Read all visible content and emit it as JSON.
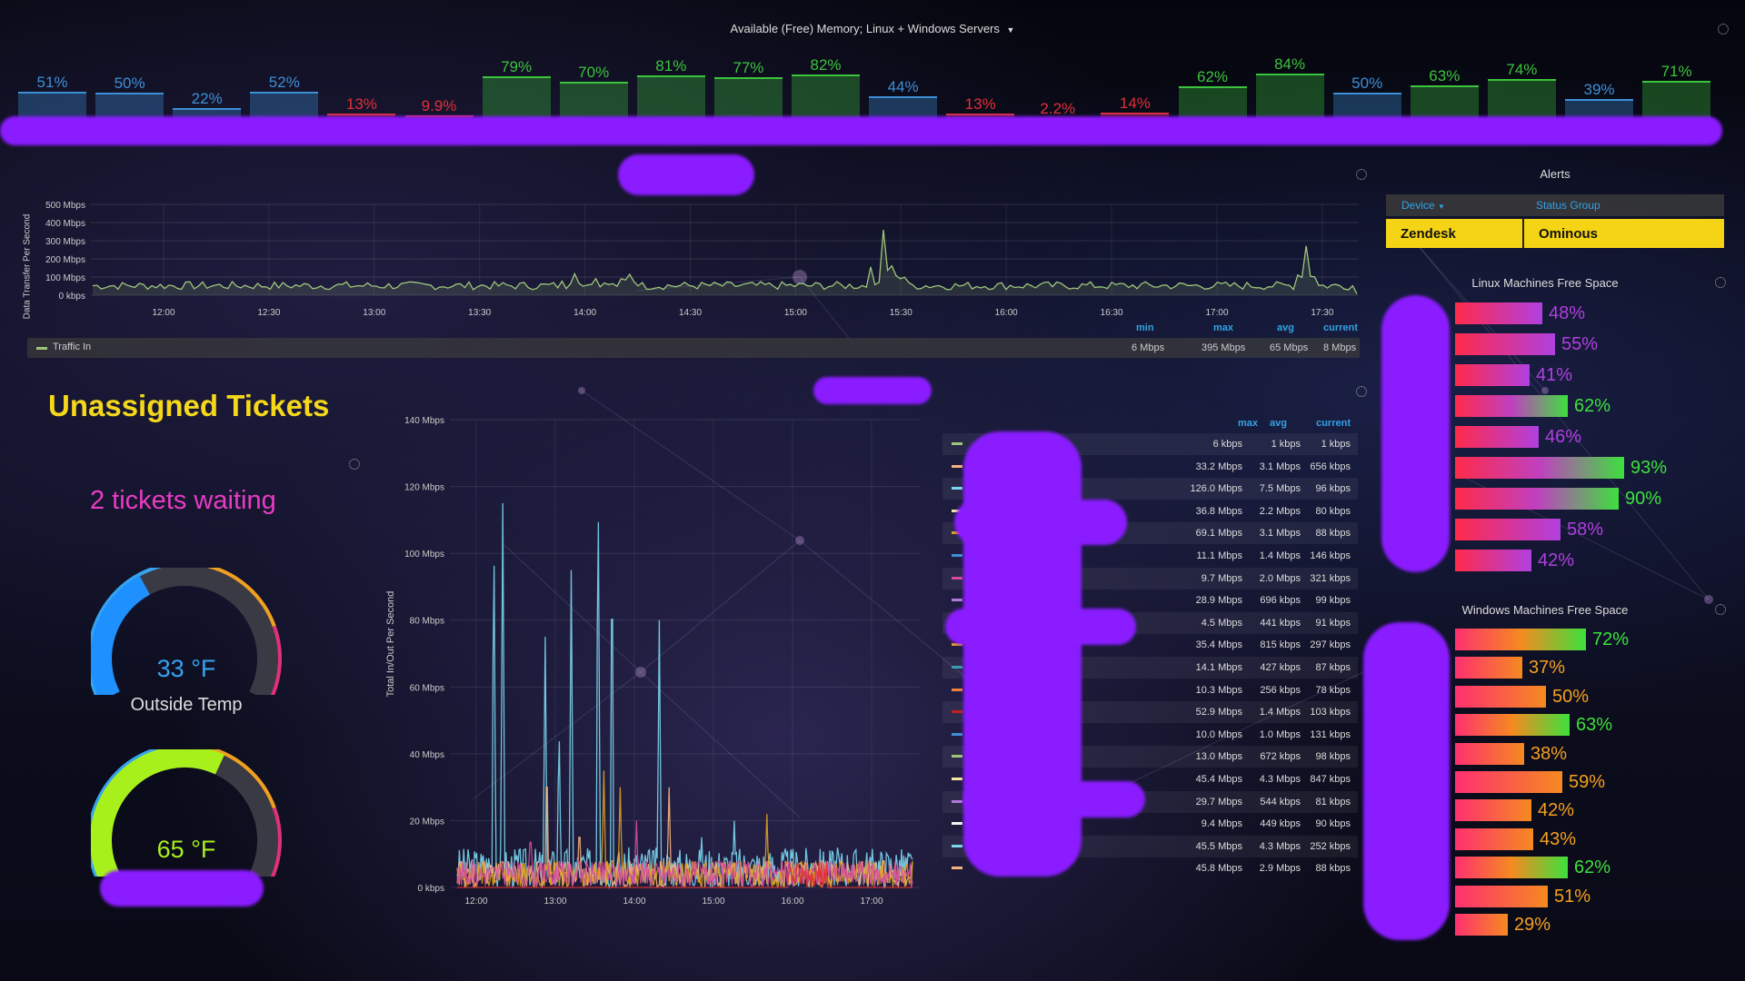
{
  "memory_panel": {
    "title": "Available (Free) Memory; Linux + Windows Servers",
    "bars": [
      {
        "value": 51,
        "label": "51%",
        "color": "#3d8fd8"
      },
      {
        "value": 50,
        "label": "50%",
        "color": "#3d8fd8"
      },
      {
        "value": 22,
        "label": "22%",
        "color": "#3d8fd8"
      },
      {
        "value": 52,
        "label": "52%",
        "color": "#3d8fd8"
      },
      {
        "value": 13,
        "label": "13%",
        "color": "#e0303a"
      },
      {
        "value": 9.9,
        "label": "9.9%",
        "color": "#e0303a"
      },
      {
        "value": 79,
        "label": "79%",
        "color": "#3cc43c"
      },
      {
        "value": 70,
        "label": "70%",
        "color": "#3cc43c"
      },
      {
        "value": 81,
        "label": "81%",
        "color": "#3cc43c"
      },
      {
        "value": 77,
        "label": "77%",
        "color": "#3cc43c"
      },
      {
        "value": 82,
        "label": "82%",
        "color": "#3cc43c"
      },
      {
        "value": 44,
        "label": "44%",
        "color": "#3d8fd8"
      },
      {
        "value": 13,
        "label": "13%",
        "color": "#e0303a"
      },
      {
        "value": 2.2,
        "label": "2.2%",
        "color": "#e0303a"
      },
      {
        "value": 14,
        "label": "14%",
        "color": "#e0303a"
      },
      {
        "value": 62,
        "label": "62%",
        "color": "#3cc43c"
      },
      {
        "value": 84,
        "label": "84%",
        "color": "#3cc43c"
      },
      {
        "value": 50,
        "label": "50%",
        "color": "#3d8fd8"
      },
      {
        "value": 63,
        "label": "63%",
        "color": "#3cc43c"
      },
      {
        "value": 74,
        "label": "74%",
        "color": "#3cc43c"
      },
      {
        "value": 39,
        "label": "39%",
        "color": "#3d8fd8"
      },
      {
        "value": 71,
        "label": "71%",
        "color": "#3cc43c"
      }
    ]
  },
  "traffic_chart": {
    "ylabel": "Data Transfer Per Second",
    "yticks": [
      "500 Mbps",
      "400 Mbps",
      "300 Mbps",
      "200 Mbps",
      "100 Mbps",
      "0 kbps"
    ],
    "xticks": [
      "12:00",
      "12:30",
      "13:00",
      "13:30",
      "14:00",
      "14:30",
      "15:00",
      "15:30",
      "16:00",
      "16:30",
      "17:00",
      "17:30"
    ],
    "legend": {
      "series": "Traffic In",
      "headers": [
        "min",
        "max",
        "avg",
        "current"
      ],
      "values": [
        "6 Mbps",
        "395 Mbps",
        "65 Mbps",
        "8 Mbps"
      ]
    },
    "line_color": "#9ec67a"
  },
  "tickets": {
    "title": "Unassigned Tickets",
    "status": "2 tickets waiting"
  },
  "gauges": [
    {
      "value": 33,
      "display": "33 °F",
      "label": "Outside Temp",
      "value_color": "#35a3f0",
      "min": -20,
      "max": 120
    },
    {
      "value": 65,
      "display": "65 °F",
      "value_color": "#a8f01c",
      "min": -20,
      "max": 120
    }
  ],
  "multi_chart": {
    "ylabel": "Total In/Out Per Second",
    "yticks": [
      "140 Mbps",
      "120 Mbps",
      "100 Mbps",
      "80 Mbps",
      "60 Mbps",
      "40 Mbps",
      "20 Mbps",
      "0 kbps"
    ],
    "xticks": [
      "12:00",
      "13:00",
      "14:00",
      "15:00",
      "16:00",
      "17:00"
    ],
    "colors": [
      "#7cd7f0",
      "#f5b27c",
      "#e0a020",
      "#d44a9c",
      "#e03030"
    ]
  },
  "multi_legend": {
    "headers": [
      "max",
      "avg",
      "current"
    ],
    "rows": [
      {
        "color": "#9ec67a",
        "max": "6 kbps",
        "avg": "1 kbps",
        "current": "1 kbps"
      },
      {
        "color": "#f5b27c",
        "max": "33.2 Mbps",
        "avg": "3.1 Mbps",
        "current": "656 kbps"
      },
      {
        "color": "#7cd7f0",
        "max": "126.0 Mbps",
        "avg": "7.5 Mbps",
        "current": "96 kbps"
      },
      {
        "color": "#f5e6a0",
        "max": "36.8 Mbps",
        "avg": "2.2 Mbps",
        "current": "80 kbps"
      },
      {
        "color": "#e0a020",
        "max": "69.1 Mbps",
        "avg": "3.1 Mbps",
        "current": "88 kbps"
      },
      {
        "color": "#3d8fd8",
        "max": "11.1 Mbps",
        "avg": "1.4 Mbps",
        "current": "146 kbps"
      },
      {
        "color": "#d44a9c",
        "max": "9.7 Mbps",
        "avg": "2.0 Mbps",
        "current": "321 kbps"
      },
      {
        "color": "#b07ad8",
        "max": "28.9 Mbps",
        "avg": "696 kbps",
        "current": "99 kbps"
      },
      {
        "color": "#9ec67a",
        "max": "4.5 Mbps",
        "avg": "441 kbps",
        "current": "91 kbps"
      },
      {
        "color": "#e0a020",
        "max": "35.4 Mbps",
        "avg": "815 kbps",
        "current": "297 kbps"
      },
      {
        "color": "#3a9ab8",
        "max": "14.1 Mbps",
        "avg": "427 kbps",
        "current": "87 kbps"
      },
      {
        "color": "#f08040",
        "max": "10.3 Mbps",
        "avg": "256 kbps",
        "current": "78 kbps"
      },
      {
        "color": "#c02020",
        "max": "52.9 Mbps",
        "avg": "1.4 Mbps",
        "current": "103 kbps"
      },
      {
        "color": "#3d8fd8",
        "max": "10.0 Mbps",
        "avg": "1.0 Mbps",
        "current": "131 kbps"
      },
      {
        "color": "#9ec67a",
        "max": "13.0 Mbps",
        "avg": "672 kbps",
        "current": "98 kbps"
      },
      {
        "color": "#f5e6a0",
        "max": "45.4 Mbps",
        "avg": "4.3 Mbps",
        "current": "847 kbps"
      },
      {
        "color": "#b07ad8",
        "max": "29.7 Mbps",
        "avg": "544 kbps",
        "current": "81 kbps"
      },
      {
        "color": "#f5f5f5",
        "max": "9.4 Mbps",
        "avg": "449 kbps",
        "current": "90 kbps"
      },
      {
        "color": "#7cd7f0",
        "max": "45.5 Mbps",
        "avg": "4.3 Mbps",
        "current": "252 kbps"
      },
      {
        "color": "#f5b27c",
        "max": "45.8 Mbps",
        "avg": "2.9 Mbps",
        "current": "88 kbps"
      }
    ]
  },
  "alerts": {
    "title": "Alerts",
    "col_device": "Device",
    "col_status": "Status Group",
    "row": {
      "device": "Zendesk",
      "status": "Ominous"
    }
  },
  "linux_space": {
    "title": "Linux Machines Free Space",
    "items": [
      {
        "value": 48,
        "label": "48%"
      },
      {
        "value": 55,
        "label": "55%"
      },
      {
        "value": 41,
        "label": "41%"
      },
      {
        "value": 62,
        "label": "62%"
      },
      {
        "value": 46,
        "label": "46%"
      },
      {
        "value": 93,
        "label": "93%"
      },
      {
        "value": 90,
        "label": "90%"
      },
      {
        "value": 58,
        "label": "58%"
      },
      {
        "value": 42,
        "label": "42%"
      }
    ]
  },
  "windows_space": {
    "title": "Windows Machines Free Space",
    "items": [
      {
        "value": 72,
        "label": "72%"
      },
      {
        "value": 37,
        "label": "37%"
      },
      {
        "value": 50,
        "label": "50%"
      },
      {
        "value": 63,
        "label": "63%"
      },
      {
        "value": 38,
        "label": "38%"
      },
      {
        "value": 59,
        "label": "59%"
      },
      {
        "value": 42,
        "label": "42%"
      },
      {
        "value": 43,
        "label": "43%"
      },
      {
        "value": 62,
        "label": "62%"
      },
      {
        "value": 51,
        "label": "51%"
      },
      {
        "value": 29,
        "label": "29%"
      }
    ]
  }
}
